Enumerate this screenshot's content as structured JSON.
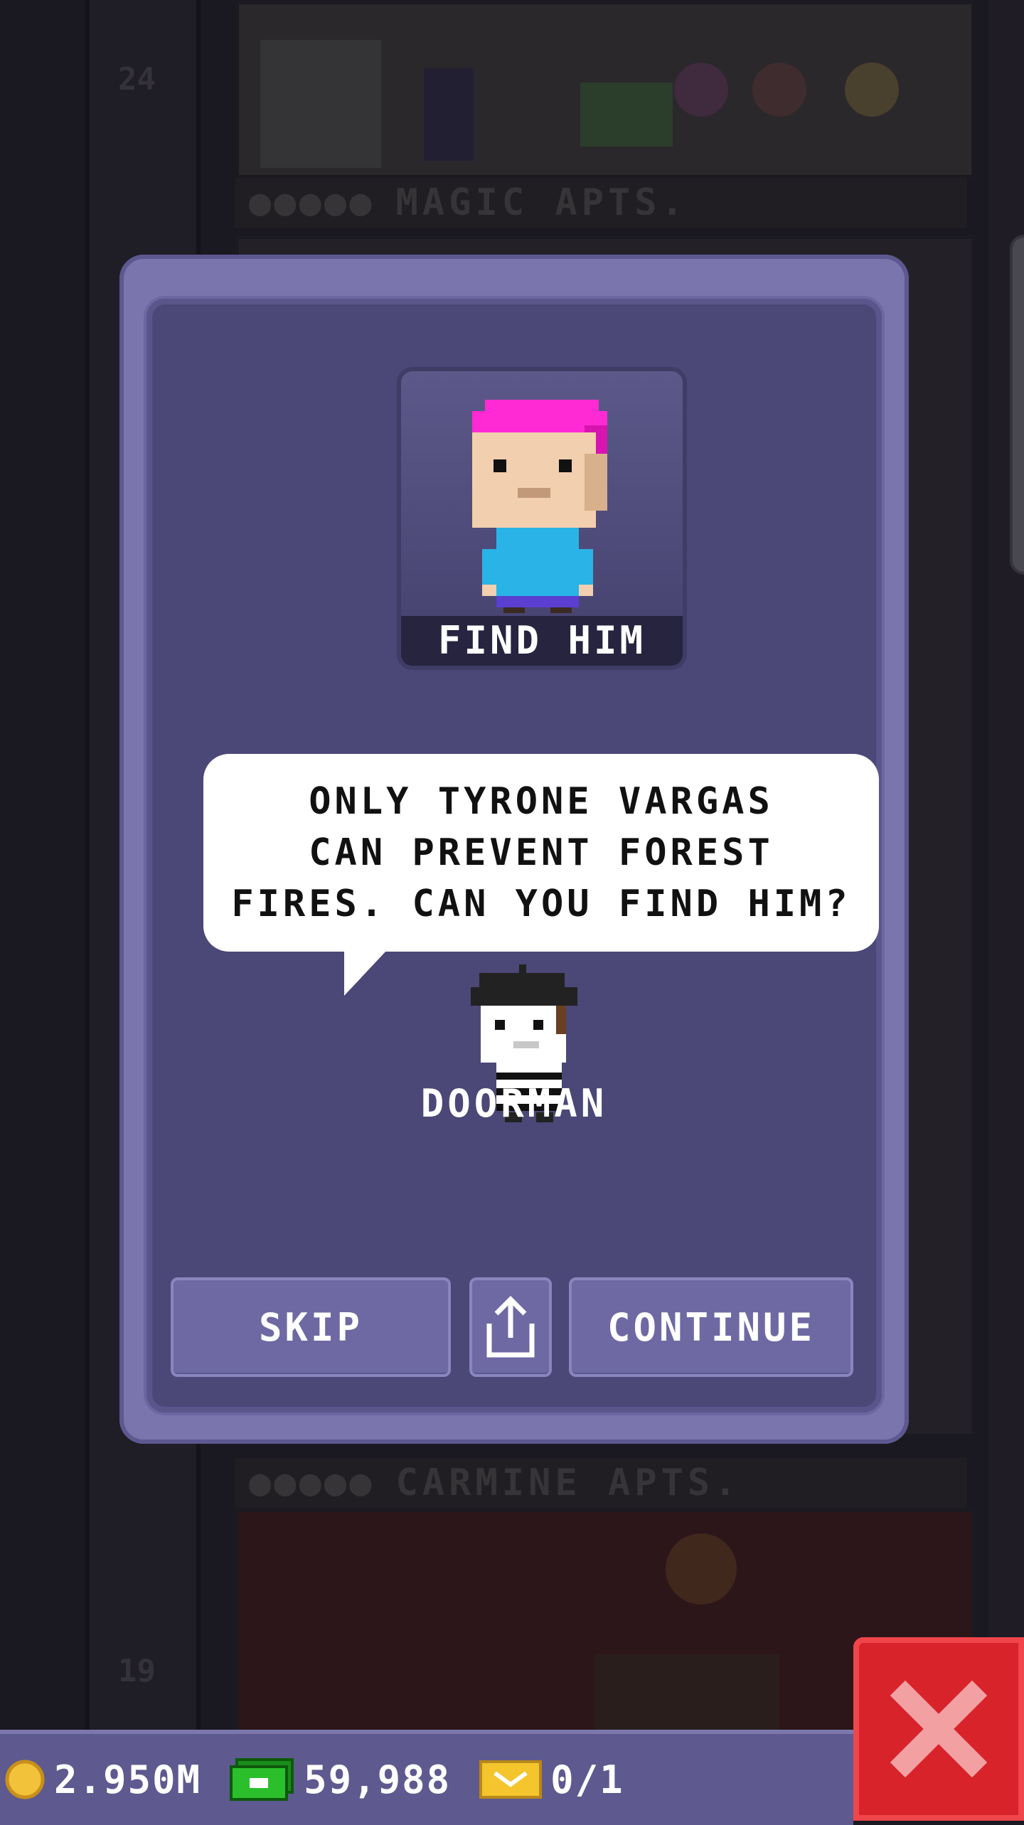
{
  "background": {
    "floors": [
      {
        "number": "24",
        "label": "MAGIC APTS."
      },
      {
        "number": "19",
        "label": "CARMINE APTS."
      }
    ]
  },
  "dialog": {
    "portrait_caption": "FIND HIM",
    "speech": "ONLY TYRONE VARGAS\nCAN PREVENT FOREST\nFIRES. CAN YOU FIND HIM?",
    "speaker": "DOORMAN",
    "buttons": {
      "skip": "SKIP",
      "continue": "CONTINUE"
    }
  },
  "status_bar": {
    "coins": "2.950M",
    "bux": "59,988",
    "tickets": "0/1"
  },
  "colors": {
    "dialog": "#7a75ad",
    "panel": "#4b4777",
    "button": "#6e69a3",
    "close": "#d8232a",
    "hair": "#ff2ad4",
    "shirt": "#2ab3e6"
  },
  "icons": {
    "share": "share-icon",
    "close": "close-icon",
    "coin": "coin-icon",
    "bux": "bux-icon",
    "ticket": "ticket-icon"
  }
}
